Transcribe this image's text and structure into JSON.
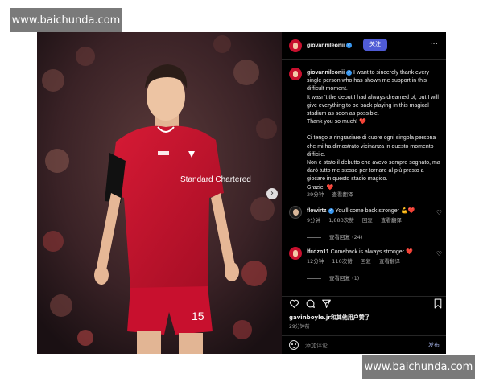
{
  "watermark": {
    "top": "www.baichunda.com",
    "bottom": "www.baichunda.com"
  },
  "post": {
    "username": "giovannileonii",
    "follow_label": "关注",
    "more_label": "···",
    "caption": {
      "username": "giovannileonii",
      "lines_en": [
        "I want to sincerely thank every single person who has shown me support in this difficult moment.",
        "It wasn't the debut I had always dreamed of, but I will give everything to be back playing in this magical stadium as soon as possible.",
        "Thank you so much!"
      ],
      "lines_it": [
        "Ci tengo a ringraziare di cuore ogni singola persona che mi ha dimostrato vicinanza in questo momento difficile.",
        "Non è stato il debutto che avevo sempre sognato, ma darò tutto me stesso per tornare al più presto a giocare in questo stadio magico.",
        "Grazie!"
      ],
      "heart": "❤️",
      "time": "29分钟",
      "translate_label": "查看翻译"
    },
    "comments": [
      {
        "username": "flowirtz",
        "text": "You'll come back stronger",
        "emoji": "💪❤️",
        "time": "9分钟",
        "likes": "1,883次赞",
        "reply_label": "回复",
        "translate_label": "查看翻译",
        "replies_label": "查看回复 (24)"
      },
      {
        "username": "lfcdzn11",
        "text": "Comeback is always stronger",
        "emoji": "❤️",
        "time": "12分钟",
        "likes": "110次赞",
        "reply_label": "回复",
        "translate_label": "查看翻译",
        "replies_label": "查看回复 (1)"
      }
    ],
    "liked_by": "gavinboyle.jr和其他用户赞了",
    "timestamp": "29分钟前",
    "comment_placeholder": "添加评论...",
    "post_button": "发布",
    "icons": [
      "heart-icon",
      "comment-icon",
      "share-icon",
      "bookmark-icon",
      "emoji-icon",
      "more-icon",
      "chevron-right-icon"
    ]
  },
  "photo": {
    "shirt_sponsor": "Standard Chartered",
    "shirt_number": "15",
    "colors": {
      "kit_red": "#c8102e",
      "background": "#2a1a1e"
    }
  },
  "colors": {
    "follow_button": "#4f5bd5",
    "verified": "#3897f0",
    "panel_bg": "#000000",
    "heart": "#ff3040"
  }
}
